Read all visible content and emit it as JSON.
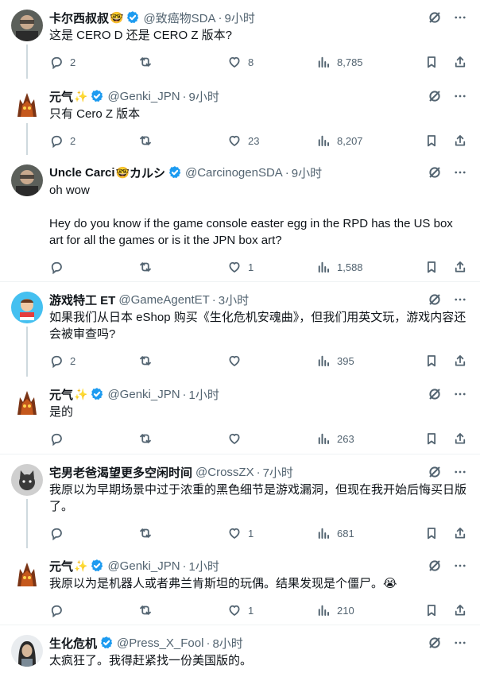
{
  "tweets": [
    {
      "name": "卡尔西叔叔",
      "emoji": "🤓",
      "handle": "@致癌物SDA",
      "time": "9小时",
      "text": "这是 CERO D 还是 CERO Z 版本?",
      "replies": "2",
      "retweets": "",
      "likes": "8",
      "views": "8,785",
      "avatar": "person"
    },
    {
      "name": "元气",
      "emoji": "✨",
      "handle": "@Genki_JPN",
      "time": "9小时",
      "text": "只有 Cero Z 版本",
      "replies": "2",
      "retweets": "",
      "likes": "23",
      "views": "8,207",
      "avatar": "monster"
    },
    {
      "name": "Uncle Carci",
      "emoji": "🤓",
      "name_suffix": "カルシ",
      "handle": "@CarcinogenSDA",
      "time": "9小时",
      "text": "oh wow\n\nHey do you know if the game console easter egg in the RPD has the US box art for all the games or is it the JPN box art?",
      "replies": "",
      "retweets": "",
      "likes": "1",
      "views": "1,588",
      "avatar": "person"
    },
    {
      "name": "游戏特工 ET",
      "emoji": "",
      "handle": "@GameAgentET",
      "time": "3小时",
      "text": "如果我们从日本 eShop 购买《生化危机安魂曲》，但我们用英文玩，游戏内容还会被审查吗?",
      "replies": "2",
      "retweets": "",
      "likes": "",
      "views": "395",
      "avatar": "agent"
    },
    {
      "name": "元气",
      "emoji": "✨",
      "handle": "@Genki_JPN",
      "time": "1小时",
      "text": "是的",
      "replies": "",
      "retweets": "",
      "likes": "",
      "views": "263",
      "avatar": "monster"
    },
    {
      "name": "宅男老爸渴望更多空闲时间",
      "emoji": "",
      "handle": "@CrossZX",
      "time": "7小时",
      "text": "我原以为早期场景中过于浓重的黑色细节是游戏漏洞，但现在我开始后悔买日版了。",
      "replies": "",
      "retweets": "",
      "likes": "1",
      "views": "681",
      "avatar": "cat"
    },
    {
      "name": "元气",
      "emoji": "✨",
      "handle": "@Genki_JPN",
      "time": "1小时",
      "text": "我原以为是机器人或者弗兰肯斯坦的玩偶。结果发现是个僵尸。😭",
      "replies": "",
      "retweets": "",
      "likes": "1",
      "views": "210",
      "avatar": "monster"
    },
    {
      "name": "生化危机",
      "emoji": "",
      "handle": "@Press_X_Fool",
      "time": "8小时",
      "text": "太疯狂了。我得赶紧找一份美国版的。",
      "replies": "",
      "retweets": "",
      "likes": "",
      "views": "",
      "avatar": "woman"
    }
  ],
  "colors": {
    "verified": "#1d9bf0",
    "text_secondary": "#536471",
    "thread_line": "#cfd9de"
  },
  "icons": [
    "verified-badge-icon",
    "grok-icon",
    "more-icon",
    "reply-icon",
    "retweet-icon",
    "like-icon",
    "views-icon",
    "bookmark-icon",
    "share-icon"
  ]
}
